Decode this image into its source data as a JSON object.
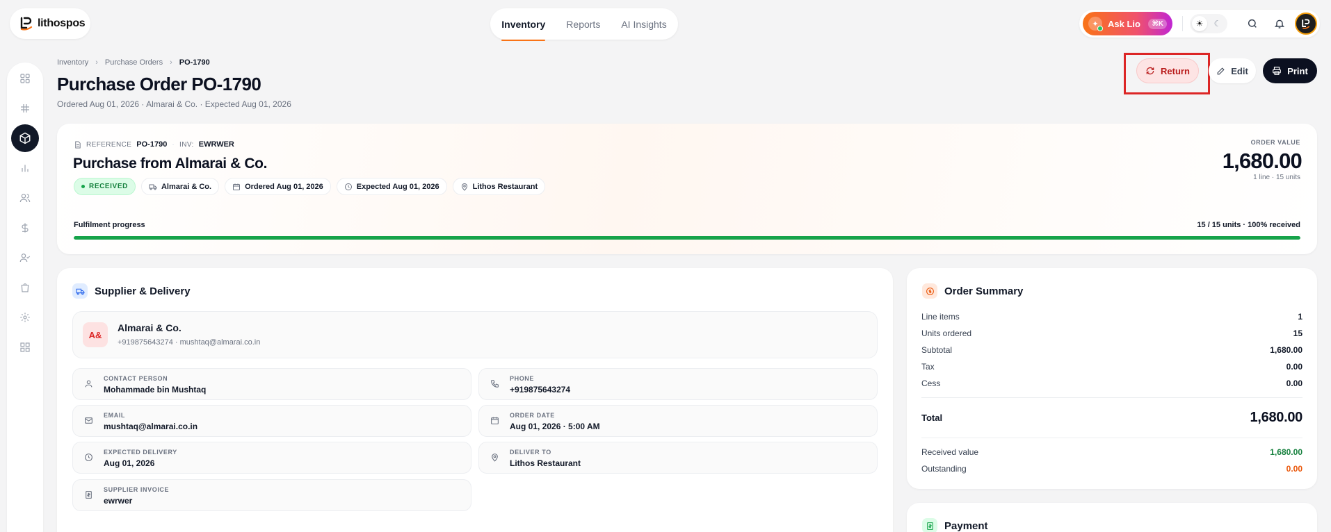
{
  "brand": {
    "name": "lithospos"
  },
  "topnav": {
    "tabs": [
      "Inventory",
      "Reports",
      "AI Insights"
    ],
    "active": "Inventory"
  },
  "topright": {
    "ask_label": "Ask Lio",
    "ask_kbd": "⌘K"
  },
  "breadcrumb": {
    "items": [
      "Inventory",
      "Purchase Orders"
    ],
    "current": "PO-1790"
  },
  "page": {
    "title": "Purchase Order PO-1790",
    "subtitle": "Ordered Aug 01, 2026 · Almarai & Co. · Expected Aug 01, 2026"
  },
  "actions": {
    "return": "Return",
    "edit": "Edit",
    "print": "Print"
  },
  "hero": {
    "reference_label": "REFERENCE",
    "reference": "PO-1790",
    "inv_label": "INV:",
    "inv": "EWRWER",
    "title": "Purchase from Almarai & Co.",
    "status": "RECEIVED",
    "chips": {
      "supplier": "Almarai & Co.",
      "ordered": "Ordered Aug 01, 2026",
      "expected": "Expected Aug 01, 2026",
      "location": "Lithos Restaurant"
    },
    "order_value_label": "ORDER VALUE",
    "order_value": "1,680.00",
    "order_value_sub": "1 line · 15 units",
    "progress_label": "Fulfilment progress",
    "progress_text": "15 / 15 units · 100% received",
    "progress_fraction": 1.0,
    "accent_color": "#16a34a"
  },
  "supplier": {
    "card_title": "Supplier & Delivery",
    "avatar": "A&",
    "name": "Almarai & Co.",
    "meta": "+919875643274 · mushtaq@almarai.co.in",
    "fields": {
      "contact_label": "CONTACT PERSON",
      "contact": "Mohammade bin Mushtaq",
      "phone_label": "PHONE",
      "phone": "+919875643274",
      "email_label": "EMAIL",
      "email": "mushtaq@almarai.co.in",
      "order_date_label": "ORDER DATE",
      "order_date": "Aug 01, 2026 · 5:00 AM",
      "expected_label": "EXPECTED DELIVERY",
      "expected": "Aug 01, 2026",
      "deliver_label": "DELIVER TO",
      "deliver": "Lithos Restaurant",
      "invoice_label": "SUPPLIER INVOICE",
      "invoice": "ewrwer"
    }
  },
  "summary": {
    "card_title": "Order Summary",
    "rows": [
      {
        "label": "Line items",
        "value": "1"
      },
      {
        "label": "Units ordered",
        "value": "15"
      },
      {
        "label": "Subtotal",
        "value": "1,680.00"
      },
      {
        "label": "Tax",
        "value": "0.00"
      },
      {
        "label": "Cess",
        "value": "0.00"
      }
    ],
    "total_label": "Total",
    "total": "1,680.00",
    "received_label": "Received value",
    "received": "1,680.00",
    "outstanding_label": "Outstanding",
    "outstanding": "0.00"
  },
  "payment": {
    "card_title": "Payment"
  }
}
